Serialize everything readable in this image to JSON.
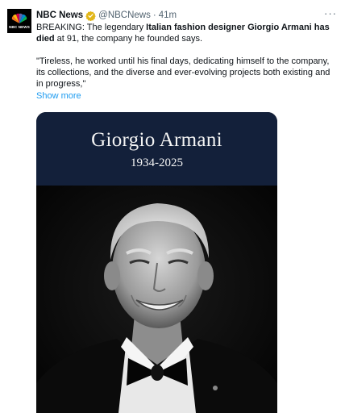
{
  "tweet": {
    "author_name": "NBC News",
    "handle": "@NBCNews",
    "separator": "·",
    "time": "41m",
    "more_icon": "···",
    "avatar_text": "NBC NEWS",
    "text_lead": "BREAKING: The legendary ",
    "text_bold": "Italian fashion designer Giorgio Armani has died",
    "text_tail": " at 91, the company he founded says.",
    "quote": "\"Tireless, he worked until his final days, dedicating himself to the company, its collections, and the diverse and ever-evolving projects both existing and in progress,\"",
    "show_more": "Show more"
  },
  "media": {
    "title": "Giorgio Armani",
    "years": "1934-2025",
    "header_color": "#13203a",
    "photo_style": "black-and-white portrait"
  },
  "colors": {
    "link": "#1d9bf0",
    "muted": "#536471",
    "verified": "#e2b719"
  }
}
